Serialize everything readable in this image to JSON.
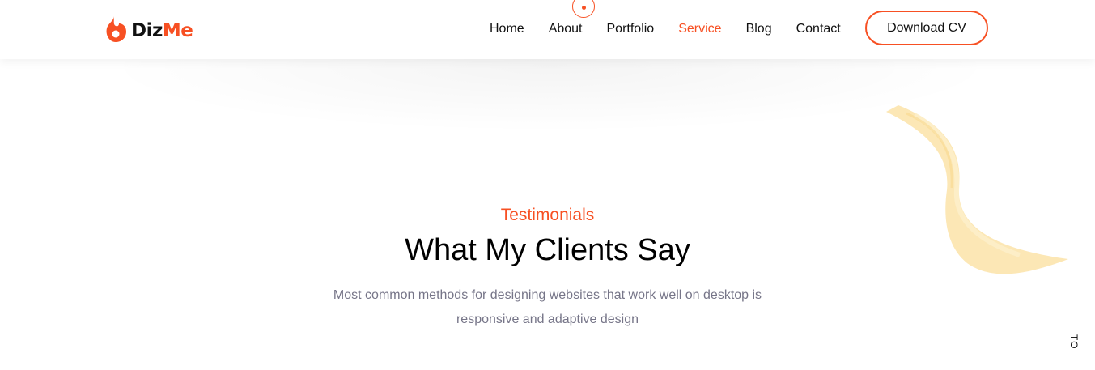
{
  "brand": {
    "name_part1": "Diz",
    "name_part2": "Me",
    "accent_color": "#f75023"
  },
  "nav": {
    "items": [
      {
        "label": "Home"
      },
      {
        "label": "About"
      },
      {
        "label": "Portfolio"
      },
      {
        "label": "Service",
        "active": true
      },
      {
        "label": "Blog"
      },
      {
        "label": "Contact"
      }
    ]
  },
  "header": {
    "download_label": "Download CV"
  },
  "section": {
    "tag": "Testimonials",
    "title": "What My Clients Say",
    "description": "Most common methods for designing websites that work well on desktop is responsive and adaptive design"
  },
  "to_top": {
    "label": "TO TOP"
  },
  "colors": {
    "accent": "#f75023",
    "text": "#111111",
    "muted": "#767588",
    "brush": "#fbe3a8"
  }
}
